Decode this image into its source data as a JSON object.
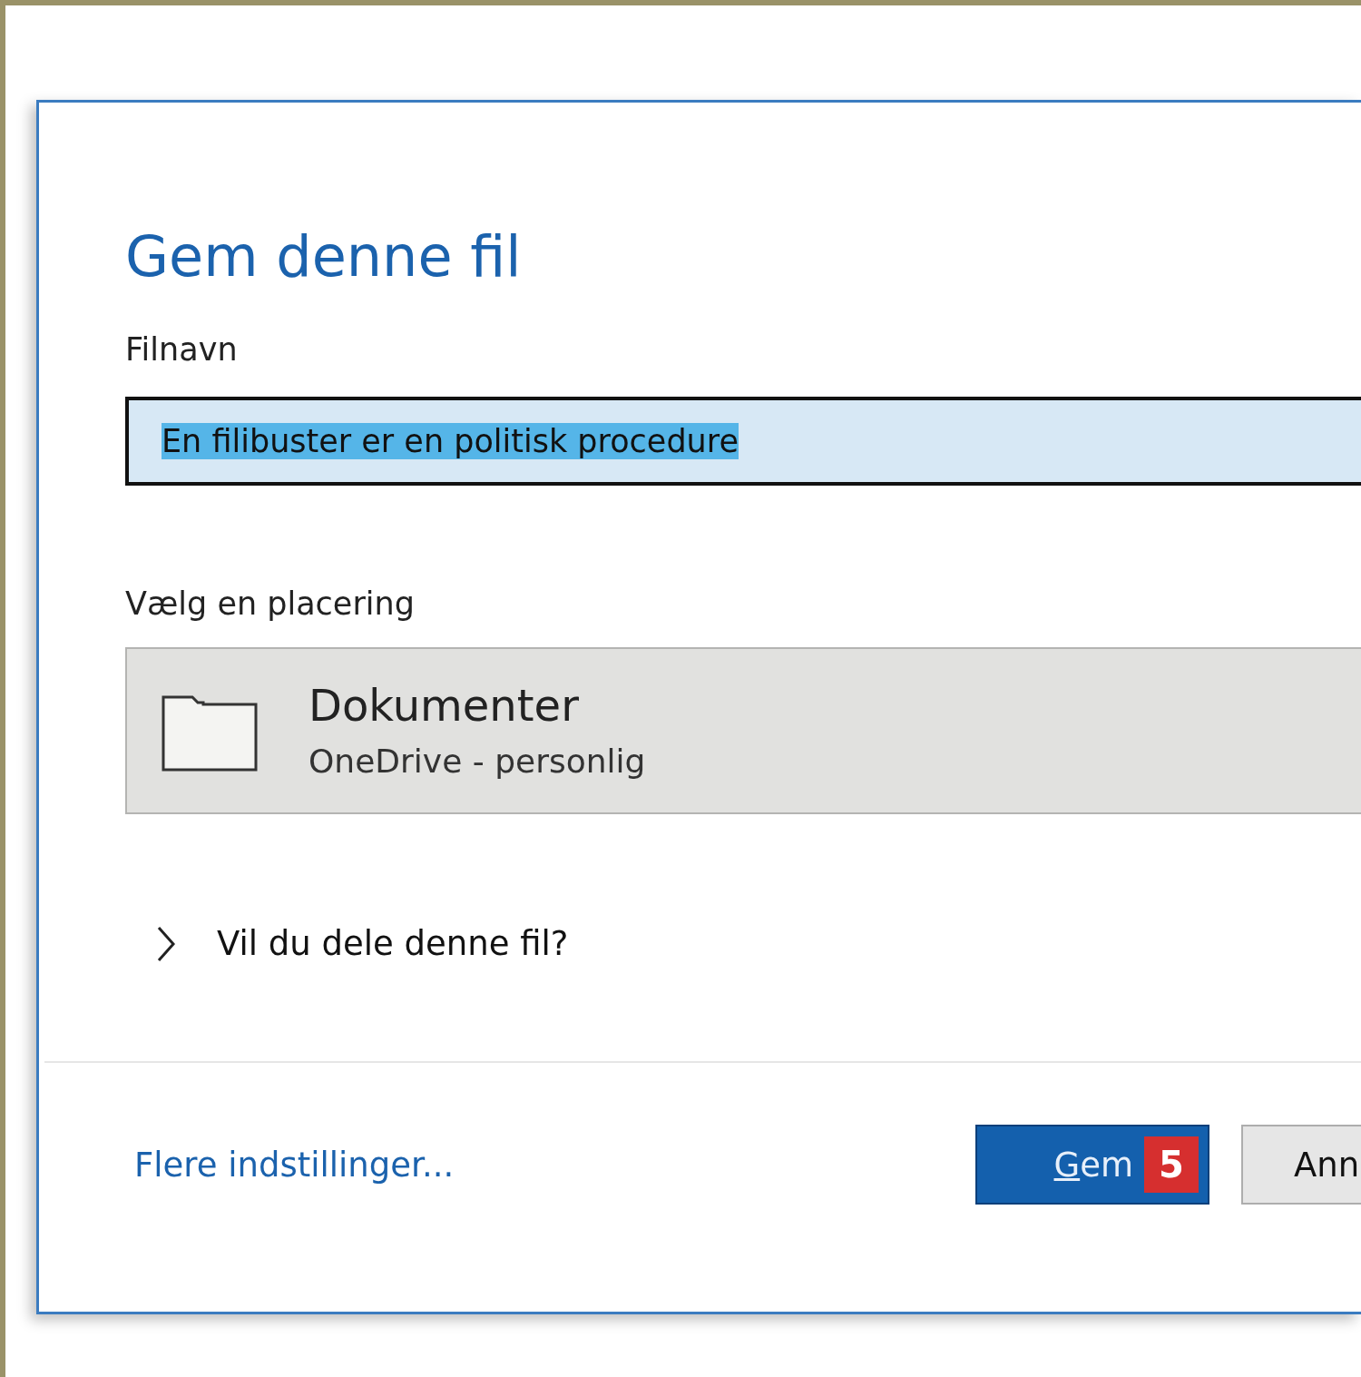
{
  "dialog": {
    "title": "Gem denne fil",
    "filename": {
      "label": "Filnavn",
      "value": "En filibuster er en politisk procedure",
      "selected": true
    },
    "location": {
      "label": "Vælg en placering",
      "name": "Dokumenter",
      "service": "OneDrive - personlig"
    },
    "share": {
      "label": "Vil du dele denne fil?",
      "expanded": false
    },
    "more_link": "Flere indstillinger...",
    "buttons": [
      {
        "kind": "primary",
        "label": "Gem",
        "badge": "5"
      },
      {
        "kind": "secondary",
        "label": "Ann"
      }
    ]
  }
}
